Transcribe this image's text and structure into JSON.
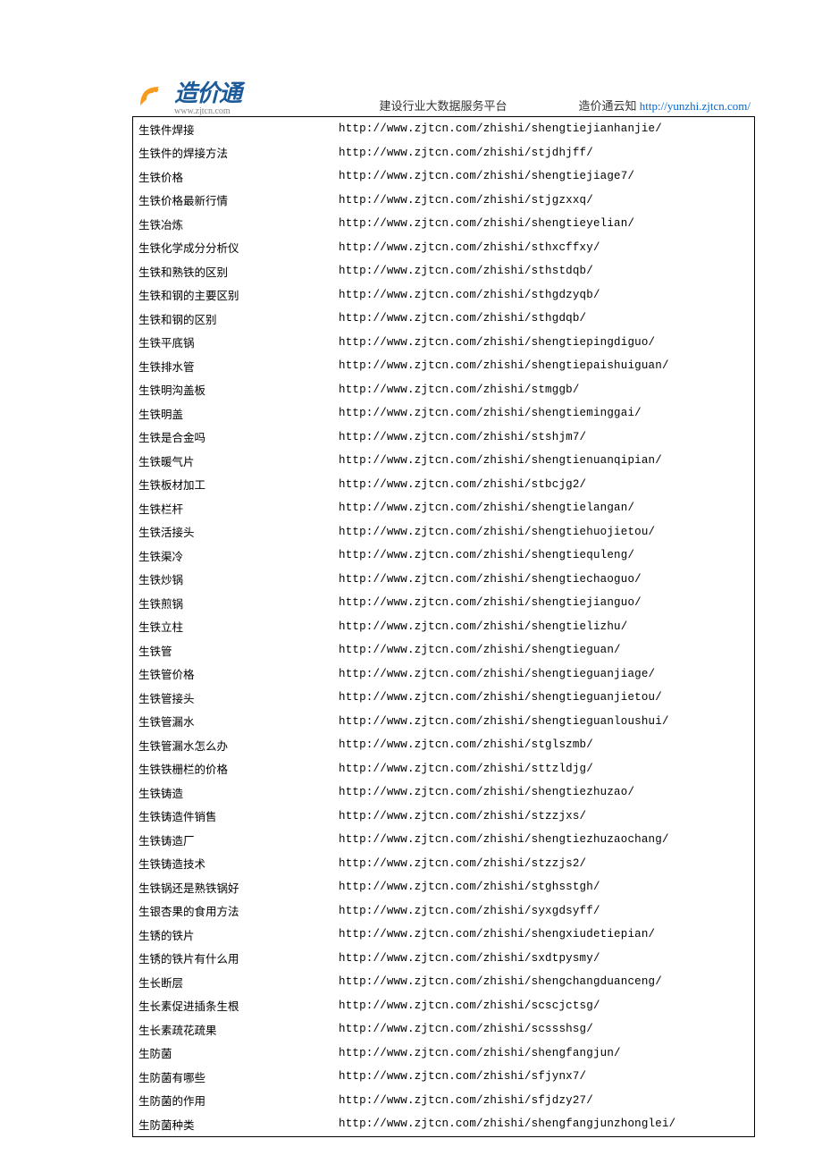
{
  "header": {
    "logo_text": "造价通",
    "logo_domain": "www.zjtcn.com",
    "platform_label": "建设行业大数据服务平台",
    "yunzhi_prefix": "造价通云知",
    "yunzhi_link": "http://yunzhi.zjtcn.com/"
  },
  "rows": [
    {
      "name": "生铁件焊接",
      "url": "http://www.zjtcn.com/zhishi/shengtiejianhanjie/"
    },
    {
      "name": "生铁件的焊接方法",
      "url": "http://www.zjtcn.com/zhishi/stjdhjff/"
    },
    {
      "name": "生铁价格",
      "url": "http://www.zjtcn.com/zhishi/shengtiejiage7/"
    },
    {
      "name": "生铁价格最新行情",
      "url": "http://www.zjtcn.com/zhishi/stjgzxxq/"
    },
    {
      "name": "生铁冶炼",
      "url": "http://www.zjtcn.com/zhishi/shengtieyelian/"
    },
    {
      "name": "生铁化学成分分析仪",
      "url": "http://www.zjtcn.com/zhishi/sthxcffxy/"
    },
    {
      "name": "生铁和熟铁的区别",
      "url": "http://www.zjtcn.com/zhishi/sthstdqb/"
    },
    {
      "name": "生铁和钢的主要区别",
      "url": "http://www.zjtcn.com/zhishi/sthgdzyqb/"
    },
    {
      "name": "生铁和钢的区别",
      "url": "http://www.zjtcn.com/zhishi/sthgdqb/"
    },
    {
      "name": "生铁平底锅",
      "url": "http://www.zjtcn.com/zhishi/shengtiepingdiguo/"
    },
    {
      "name": "生铁排水管",
      "url": "http://www.zjtcn.com/zhishi/shengtiepaishuiguan/"
    },
    {
      "name": "生铁明沟盖板",
      "url": "http://www.zjtcn.com/zhishi/stmggb/"
    },
    {
      "name": "生铁明盖",
      "url": "http://www.zjtcn.com/zhishi/shengtieminggai/"
    },
    {
      "name": "生铁是合金吗",
      "url": "http://www.zjtcn.com/zhishi/stshjm7/"
    },
    {
      "name": "生铁暖气片",
      "url": "http://www.zjtcn.com/zhishi/shengtienuanqipian/"
    },
    {
      "name": "生铁板材加工",
      "url": "http://www.zjtcn.com/zhishi/stbcjg2/"
    },
    {
      "name": "生铁栏杆",
      "url": "http://www.zjtcn.com/zhishi/shengtielangan/"
    },
    {
      "name": "生铁活接头",
      "url": "http://www.zjtcn.com/zhishi/shengtiehuojietou/"
    },
    {
      "name": "生铁渠冷",
      "url": "http://www.zjtcn.com/zhishi/shengtiequleng/"
    },
    {
      "name": "生铁炒锅",
      "url": "http://www.zjtcn.com/zhishi/shengtiechaoguo/"
    },
    {
      "name": "生铁煎锅",
      "url": "http://www.zjtcn.com/zhishi/shengtiejianguo/"
    },
    {
      "name": "生铁立柱",
      "url": "http://www.zjtcn.com/zhishi/shengtielizhu/"
    },
    {
      "name": "生铁管",
      "url": "http://www.zjtcn.com/zhishi/shengtieguan/"
    },
    {
      "name": "生铁管价格",
      "url": "http://www.zjtcn.com/zhishi/shengtieguanjiage/"
    },
    {
      "name": "生铁管接头",
      "url": "http://www.zjtcn.com/zhishi/shengtieguanjietou/"
    },
    {
      "name": "生铁管漏水",
      "url": "http://www.zjtcn.com/zhishi/shengtieguanloushui/"
    },
    {
      "name": "生铁管漏水怎么办",
      "url": "http://www.zjtcn.com/zhishi/stglszmb/"
    },
    {
      "name": "生铁铁栅栏的价格",
      "url": "http://www.zjtcn.com/zhishi/sttzldjg/"
    },
    {
      "name": "生铁铸造",
      "url": "http://www.zjtcn.com/zhishi/shengtiezhuzao/"
    },
    {
      "name": "生铁铸造件销售",
      "url": "http://www.zjtcn.com/zhishi/stzzjxs/"
    },
    {
      "name": "生铁铸造厂",
      "url": "http://www.zjtcn.com/zhishi/shengtiezhuzaochang/"
    },
    {
      "name": "生铁铸造技术",
      "url": "http://www.zjtcn.com/zhishi/stzzjs2/"
    },
    {
      "name": "生铁锅还是熟铁锅好",
      "url": "http://www.zjtcn.com/zhishi/stghsstgh/"
    },
    {
      "name": "生银杏果的食用方法",
      "url": "http://www.zjtcn.com/zhishi/syxgdsyff/"
    },
    {
      "name": "生锈的铁片",
      "url": "http://www.zjtcn.com/zhishi/shengxiudetiepian/"
    },
    {
      "name": "生锈的铁片有什么用",
      "url": "http://www.zjtcn.com/zhishi/sxdtpysmy/"
    },
    {
      "name": "生长断层",
      "url": "http://www.zjtcn.com/zhishi/shengchangduanceng/"
    },
    {
      "name": "生长素促进插条生根",
      "url": "http://www.zjtcn.com/zhishi/scscjctsg/"
    },
    {
      "name": "生长素疏花疏果",
      "url": "http://www.zjtcn.com/zhishi/scssshsg/"
    },
    {
      "name": "生防菌",
      "url": "http://www.zjtcn.com/zhishi/shengfangjun/"
    },
    {
      "name": "生防菌有哪些",
      "url": "http://www.zjtcn.com/zhishi/sfjynx7/"
    },
    {
      "name": "生防菌的作用",
      "url": "http://www.zjtcn.com/zhishi/sfjdzy27/"
    },
    {
      "name": "生防菌种类",
      "url": "http://www.zjtcn.com/zhishi/shengfangjunzhonglei/"
    }
  ]
}
